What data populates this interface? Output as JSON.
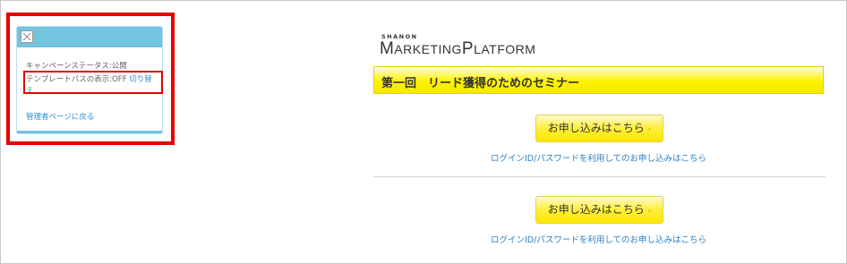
{
  "panel": {
    "status_text": "キャンペーンステータス:公開",
    "template_label": "テンプレートパスの表示:OFF",
    "template_toggle": "切り替",
    "template_toggle_cont": "え",
    "admin_link": "管理者ページに戻る"
  },
  "logo": {
    "small": "SHANON",
    "main_m": "M",
    "main_rest1": "ARKETING",
    "main_p": "P",
    "main_rest2": "LATFORM"
  },
  "page": {
    "title": "第一回　リード獲得のためのセミナー",
    "apply_button_1": "お申し込みはこちら",
    "login_link_1": "ログインID/パスワードを利用してのお申し込みはこちら",
    "apply_button_2": "お申し込みはこちら",
    "login_link_2": "ログインID/パスワードを利用してのお申し込みはこちら"
  },
  "colors": {
    "highlight": "#e60000",
    "panel_header": "#74c3df",
    "link": "#2b7fc3",
    "title_bar": "#fff200"
  }
}
